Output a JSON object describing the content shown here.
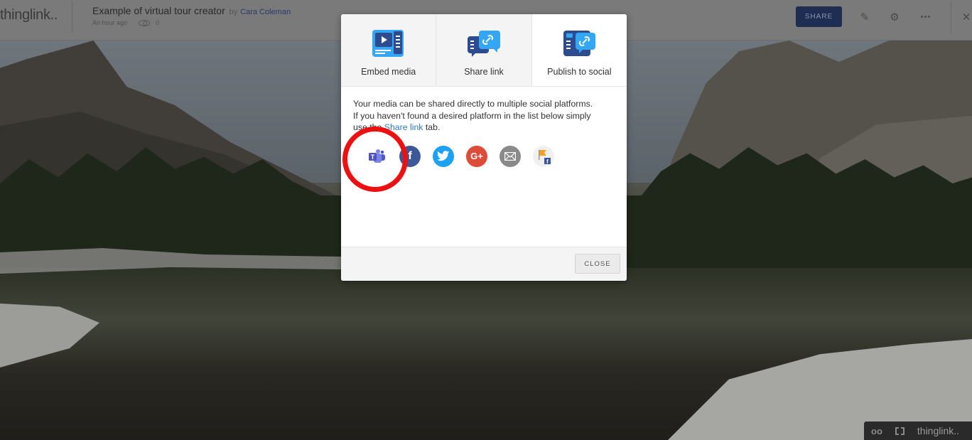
{
  "header": {
    "logo": "thinglink..",
    "title": "Example of virtual tour creator",
    "by": "by",
    "author": "Cara Coleman",
    "time": "An hour ago",
    "views": "0",
    "share_label": "SHARE",
    "icons": [
      "pencil-icon",
      "gear-icon",
      "more-icon",
      "close-icon"
    ]
  },
  "modal": {
    "tabs": [
      {
        "label": "Embed media",
        "icon": "embed-media-icon",
        "active": false
      },
      {
        "label": "Share link",
        "icon": "share-link-icon",
        "active": false
      },
      {
        "label": "Publish to social",
        "icon": "publish-social-icon",
        "active": true
      }
    ],
    "description_1": "Your media can be shared directly to multiple social platforms.",
    "description_2": "If you haven't found a desired platform in the list below simply",
    "description_3_prefix": "use the ",
    "description_link": "Share link",
    "description_3_suffix": " tab.",
    "socials": [
      {
        "name": "Microsoft Teams",
        "color": "#5b5fc7"
      },
      {
        "name": "Facebook",
        "color": "#3b5998"
      },
      {
        "name": "Twitter",
        "color": "#1da1f2"
      },
      {
        "name": "Google+",
        "color": "#dd4b39"
      },
      {
        "name": "Email",
        "color": "#8a8a8a"
      },
      {
        "name": "Facebook Workplace",
        "color": "#f0f0f0"
      }
    ],
    "close_label": "CLOSE"
  },
  "bottom_bar": {
    "brand": "thinglink..",
    "vr": "oo"
  },
  "colors": {
    "annotation": "#ee1010",
    "share_button": "#1f2d52",
    "link": "#2f7bbf"
  }
}
